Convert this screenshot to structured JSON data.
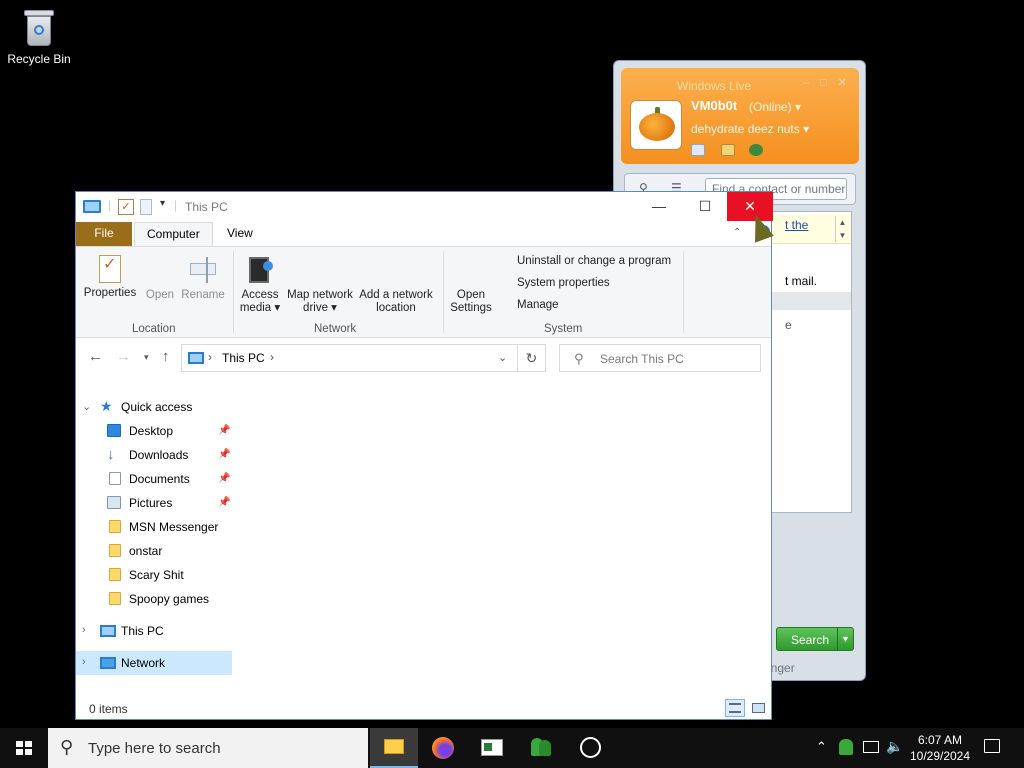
{
  "desktop": {
    "icons": [
      {
        "label": "Recycle Bin",
        "icon": "recycle-bin-icon"
      }
    ]
  },
  "messenger": {
    "title": "Windows Live",
    "username": "VM0b0t",
    "status": "(Online) ▾",
    "personal_message": "dehydrate deez nuts ▾",
    "search_placeholder": "Find a contact or number",
    "banner_link": "t the",
    "mail_text": "t mail.",
    "row_fragment": "e",
    "search_button": "Search",
    "footer_fragment": "enger"
  },
  "explorer": {
    "title": "This PC",
    "tabs": {
      "file": "File",
      "computer": "Computer",
      "view": "View"
    },
    "ribbon": {
      "location": {
        "group": "Location",
        "properties": "Properties",
        "open": "Open",
        "rename": "Rename"
      },
      "network": {
        "group": "Network",
        "access_media": "Access media ▾",
        "map_network_drive": "Map network drive ▾",
        "add_network_location": "Add a network location"
      },
      "system": {
        "group": "System",
        "open_settings": "Open Settings",
        "uninstall": "Uninstall or change a program",
        "system_properties": "System properties",
        "manage": "Manage"
      }
    },
    "address": {
      "path": "This PC",
      "separator": "›",
      "trailing": "›"
    },
    "search": {
      "placeholder": "Search This PC"
    },
    "nav": {
      "quick_access": "Quick access",
      "quick_items": [
        {
          "label": "Desktop",
          "pinned": true
        },
        {
          "label": "Downloads",
          "pinned": true
        },
        {
          "label": "Documents",
          "pinned": true
        },
        {
          "label": "Pictures",
          "pinned": true
        },
        {
          "label": "MSN Messenger",
          "pinned": false
        },
        {
          "label": "onstar",
          "pinned": false
        },
        {
          "label": "Scary Shit",
          "pinned": false
        },
        {
          "label": "Spoopy games",
          "pinned": false
        }
      ],
      "this_pc": "This PC",
      "network": "Network"
    },
    "status": "0 items"
  },
  "taskbar": {
    "search_placeholder": "Type here to search",
    "apps": [
      "file-explorer-icon",
      "firefox-icon",
      "news-icon",
      "messenger-icon",
      "alarm-clock-icon"
    ],
    "time": "6:07 AM",
    "date": "10/29/2024"
  },
  "colors": {
    "file_tab": "#9a6d1a",
    "close_red": "#e81123",
    "selection": "#cce8ff",
    "messenger_orange": "#f7a23a",
    "messenger_green": "#3aa83a"
  }
}
